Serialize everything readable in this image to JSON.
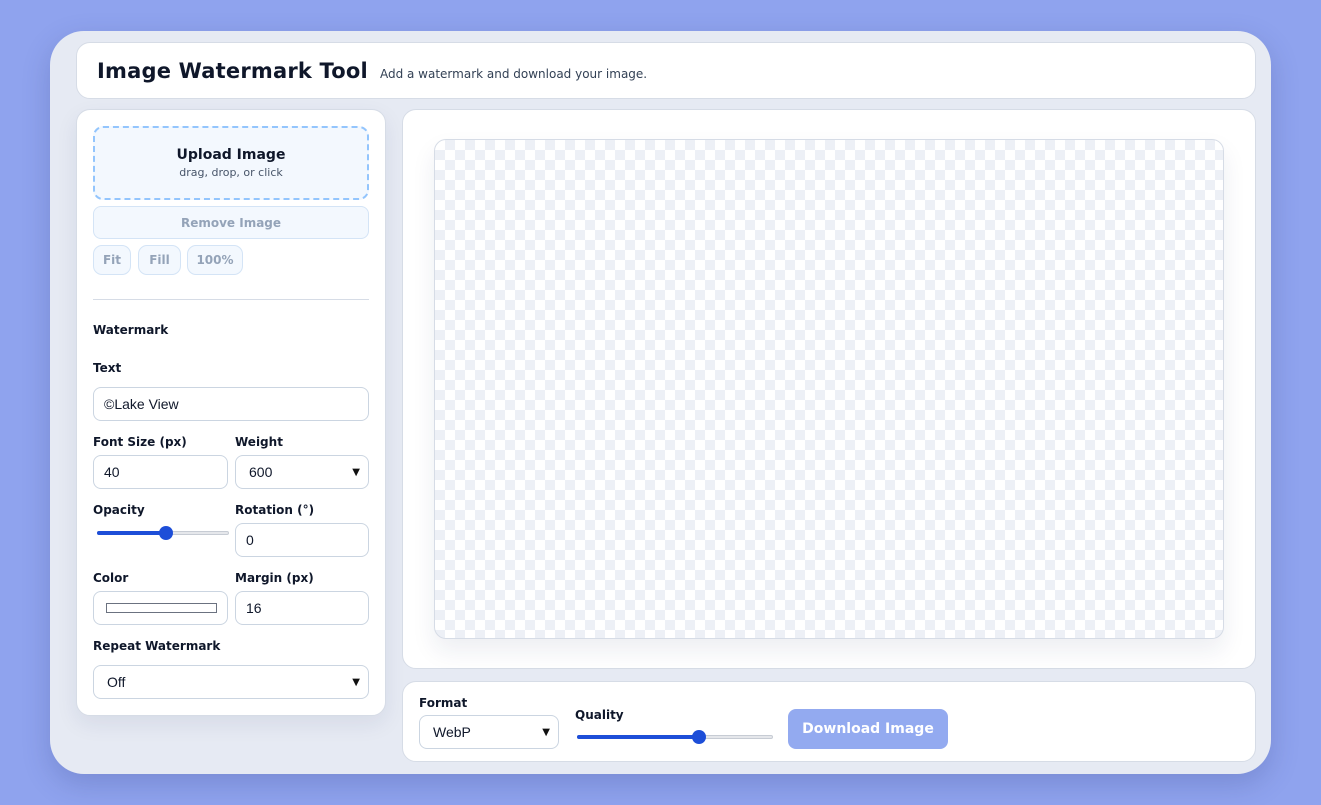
{
  "header": {
    "title": "Image Watermark Tool",
    "subtitle": "Add a watermark and download your image."
  },
  "upload": {
    "title": "Upload Image",
    "hint": "drag, drop, or click",
    "remove_label": "Remove Image",
    "view_buttons": [
      "Fit",
      "Fill",
      "100%"
    ]
  },
  "watermark": {
    "section_title": "Watermark",
    "text_label": "Text",
    "text_value": "©Lake View",
    "font_size_label": "Font Size (px)",
    "font_size_value": "40",
    "weight_label": "Weight",
    "weight_value": "600",
    "opacity_label": "Opacity",
    "opacity_fraction": 0.52,
    "rotation_label": "Rotation (°)",
    "rotation_value": "0",
    "color_label": "Color",
    "color_value": "#ffffff",
    "margin_label": "Margin (px)",
    "margin_value": "16",
    "repeat_label": "Repeat Watermark",
    "repeat_value": "Off"
  },
  "export": {
    "format_label": "Format",
    "format_value": "WebP",
    "quality_label": "Quality",
    "quality_fraction": 0.62,
    "download_label": "Download Image"
  },
  "colors": {
    "accent": "#1d4ed8",
    "download_disabled": "#93aaf0",
    "page_bg": "#8fa3ee"
  }
}
